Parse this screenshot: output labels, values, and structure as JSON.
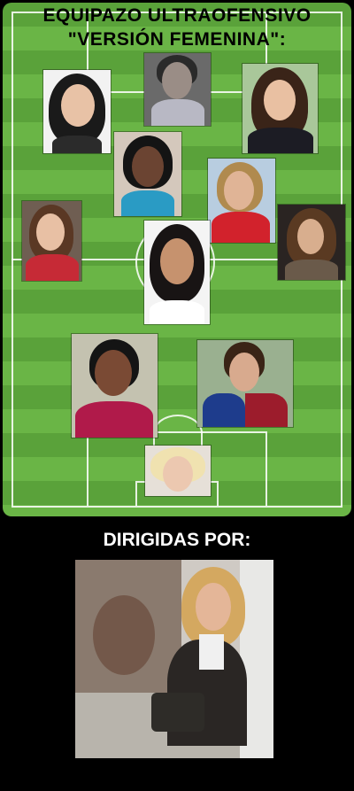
{
  "title_line1": "EQUIPAZO ULTRAOFENSIVO",
  "title_line2": "\"VERSIÓN FEMENINA\":",
  "coach_label": "DIRIGIDAS POR:",
  "icons": {
    "players": [
      "player-photo-1",
      "player-photo-2",
      "player-photo-3",
      "player-photo-4",
      "player-photo-5",
      "player-photo-6",
      "player-photo-7",
      "player-photo-8",
      "player-photo-9",
      "player-photo-10",
      "player-photo-11"
    ],
    "coach": "coach-photo"
  },
  "colors": {
    "pitch_light": "#6ab546",
    "pitch_dark": "#5aa23a",
    "lines": "#ffffff",
    "background": "#000000"
  }
}
